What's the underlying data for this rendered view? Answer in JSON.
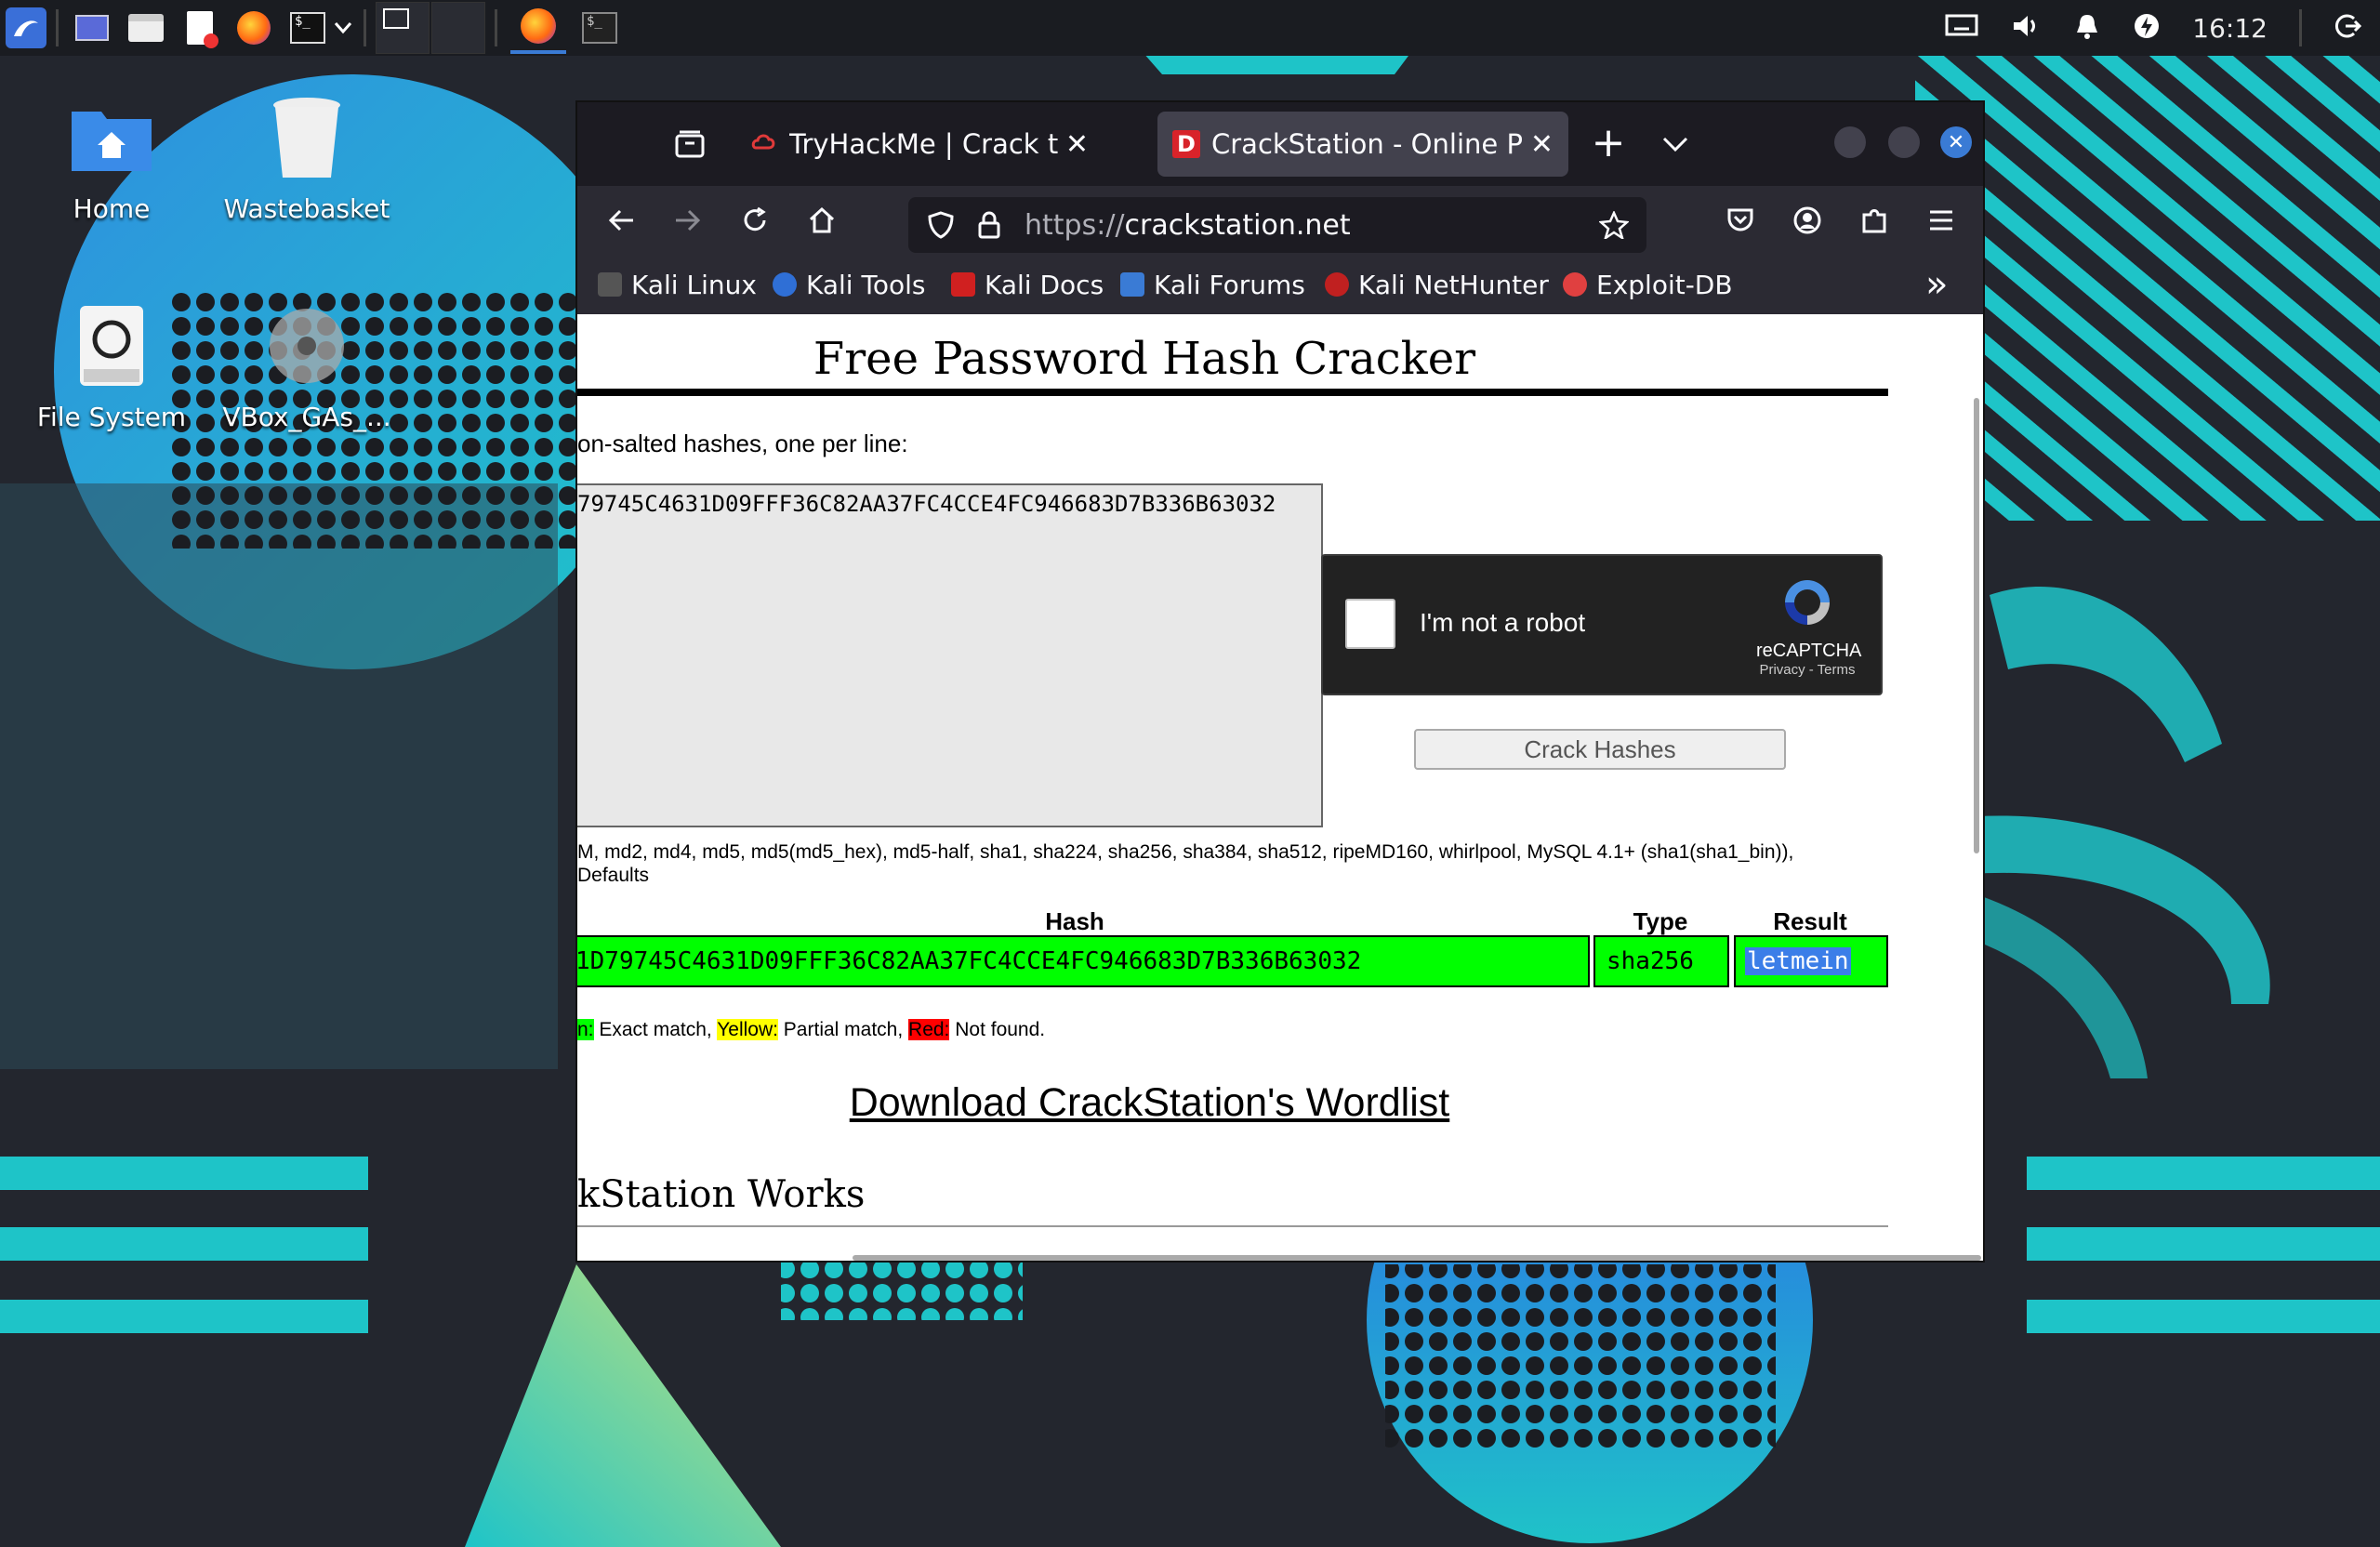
{
  "taskbar": {
    "clock": "16:12",
    "icons": [
      "kali-menu-icon",
      "desktop-switch-icon",
      "file-manager-icon",
      "text-editor-icon",
      "firefox-icon",
      "terminal-icon",
      "workspace-1",
      "workspace-2",
      "firefox-running-icon",
      "terminal-running-icon"
    ]
  },
  "desktop": {
    "icons": [
      {
        "label": "Home",
        "icon": "home-folder-icon"
      },
      {
        "label": "Wastebasket",
        "icon": "trash-icon"
      },
      {
        "label": "File System",
        "icon": "drive-icon"
      },
      {
        "label": "VBox_GAs_...",
        "icon": "disc-icon"
      }
    ]
  },
  "browser": {
    "tabs": [
      {
        "title": "TryHackMe | Crack the ha",
        "icon": "tryhackme-icon",
        "close": "✕"
      },
      {
        "title": "CrackStation - Online Pas",
        "icon": "crackstation-icon",
        "close": "✕",
        "active": true
      }
    ],
    "new_tab": "+",
    "url_prefix": "https://",
    "url_host": "crackstation.net",
    "bookmarks": [
      {
        "label": "Kali Linux",
        "color": "#111111"
      },
      {
        "label": "Kali Tools",
        "color": "#2f6fd6"
      },
      {
        "label": "Kali Docs",
        "color": "#d02020"
      },
      {
        "label": "Kali Forums",
        "color": "#3a7bd5"
      },
      {
        "label": "Kali NetHunter",
        "color": "#c02020"
      },
      {
        "label": "Exploit-DB",
        "color": "#e04040"
      }
    ],
    "overflow": "»"
  },
  "page": {
    "title": "Free Password Hash Cracker",
    "instructions": "on-salted hashes, one per line:",
    "hash_input": "79745C4631D09FFF36C82AA37FC4CCE4FC946683D7B336B63032",
    "captcha": {
      "label": "I'm not a robot",
      "brand": "reCAPTCHA",
      "links": "Privacy - Terms"
    },
    "crack_button": "Crack Hashes",
    "supports_line1": "M, md2, md4, md5, md5(md5_hex), md5-half, sha1, sha224, sha256, sha384, sha512, ripeMD160, whirlpool, MySQL 4.1+ (sha1(sha1_bin)),",
    "supports_line2": "Defaults",
    "results": {
      "headers": {
        "hash": "Hash",
        "type": "Type",
        "result": "Result"
      },
      "row": {
        "hash": "1D79745C4631D09FFF36C82AA37FC4CCE4FC946683D7B336B63032",
        "type": "sha256",
        "result": "letmein"
      }
    },
    "legend": {
      "green": "n:",
      "green_text": " Exact match, ",
      "yellow": "Yellow:",
      "yellow_text": " Partial match, ",
      "red": "Red:",
      "red_text": " Not found."
    },
    "download_link": "Download CrackStation's Wordlist",
    "how_heading": "kStation Works"
  },
  "colors": {
    "match_green": "#00ff00",
    "partial_yellow": "#ffff00",
    "notfound_red": "#ff0000",
    "selection": "#3b7ee8"
  }
}
